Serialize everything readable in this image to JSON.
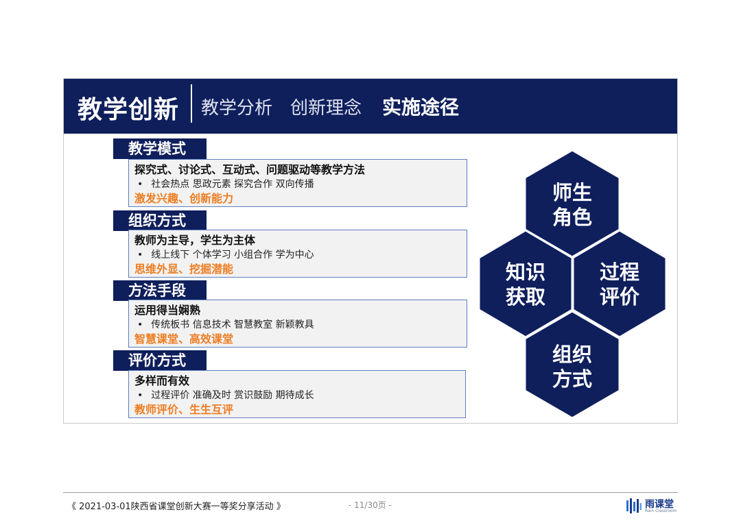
{
  "header": {
    "title": "教学创新",
    "nav": [
      "教学分析",
      "创新理念",
      "实施途径"
    ]
  },
  "sections": [
    {
      "tag": "教学模式",
      "line1": "探究式、讨论式、互动式、问题驱动等教学方法",
      "bullet": "•",
      "line2": "社会热点  思政元素  探究合作  双向传播",
      "line3": "激发兴趣、创新能力"
    },
    {
      "tag": "组织方式",
      "line1": "教师为主导，学生为主体",
      "bullet": "•",
      "line2": "线上线下  个体学习  小组合作  学为中心",
      "line3": "思维外显、挖掘潜能"
    },
    {
      "tag": "方法手段",
      "line1": "运用得当娴熟",
      "bullet": "•",
      "line2": "传统板书  信息技术  智慧教室  新颖教具",
      "line3": "智慧课堂、高效课堂"
    },
    {
      "tag": "评价方式",
      "line1": "多样而有效",
      "bullet": "•",
      "line2": "过程评价  准确及时  赏识鼓励  期待成长",
      "line3": "教师评价、生生互评"
    }
  ],
  "hexagons": [
    {
      "line1": "师生",
      "line2": "角色"
    },
    {
      "line1": "知识",
      "line2": "获取"
    },
    {
      "line1": "过程",
      "line2": "评价"
    },
    {
      "line1": "组织",
      "line2": "方式"
    }
  ],
  "colors": {
    "navy": "#0f1f5c",
    "accent_orange": "#ee7d22",
    "box_border": "#5b7fbd"
  },
  "footer": {
    "source": "《 2021-03-01陕西省课堂创新大赛一等奖分享活动 》",
    "page": "- 11/30页 -",
    "logo_name": "雨课堂",
    "logo_sub": "Rain Classroom",
    "logo_icon": "rain-classroom-logo-icon"
  }
}
